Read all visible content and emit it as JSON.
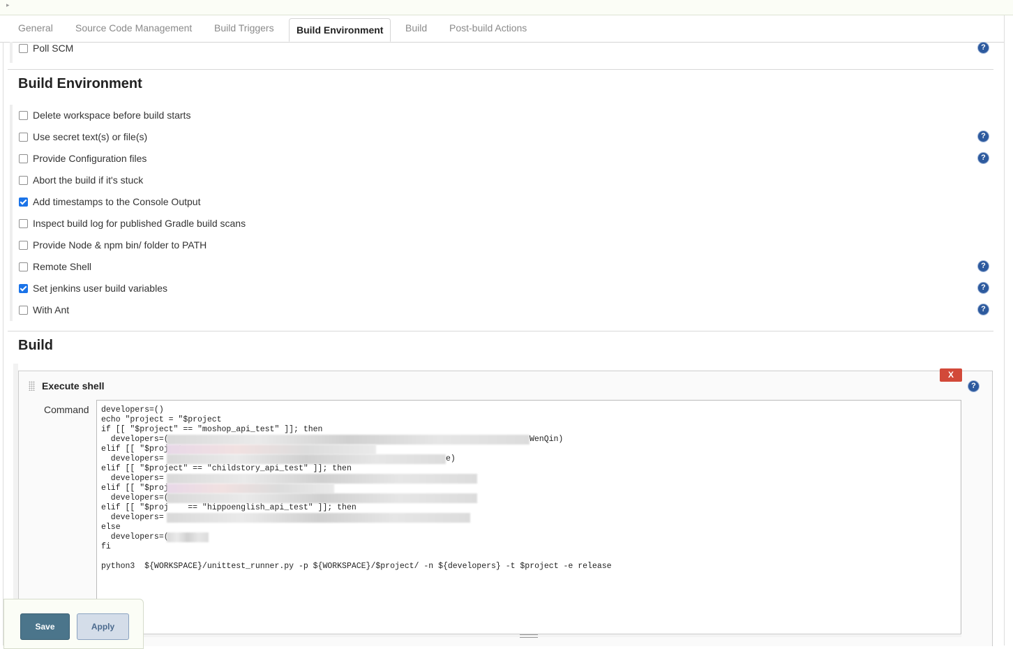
{
  "tabs": [
    "General",
    "Source Code Management",
    "Build Triggers",
    "Build Environment",
    "Build",
    "Post-build Actions"
  ],
  "active_tab": "Build Environment",
  "poll_scm": {
    "label": "Poll SCM",
    "checked": false
  },
  "build_environment": {
    "title": "Build Environment",
    "options": [
      {
        "label": "Delete workspace before build starts",
        "checked": false
      },
      {
        "label": "Use secret text(s) or file(s)",
        "checked": false
      },
      {
        "label": "Provide Configuration files",
        "checked": false
      },
      {
        "label": "Abort the build if it's stuck",
        "checked": false
      },
      {
        "label": "Add timestamps to the Console Output",
        "checked": true
      },
      {
        "label": "Inspect build log for published Gradle build scans",
        "checked": false
      },
      {
        "label": "Provide Node & npm bin/ folder to PATH",
        "checked": false
      },
      {
        "label": "Remote Shell",
        "checked": false
      },
      {
        "label": "Set jenkins user build variables",
        "checked": true
      },
      {
        "label": "With Ant",
        "checked": false
      }
    ]
  },
  "build": {
    "title": "Build",
    "step_title": "Execute shell",
    "delete_label": "X",
    "command_label": "Command",
    "command_lines": [
      "developers=()",
      "echo \"project = \"$project",
      "if [[ \"$project\" == \"moshop_api_test\" ]]; then",
      "  developers=(",
      "elif [[ \"$project",
      "  developers=",
      "elif [[ \"$project\" == \"childstory_api_test\" ]]; then",
      "  developers=",
      "elif [[ \"$proj",
      "  developers=(",
      "elif [[ \"$proj    == \"hippoenglish_api_test\" ]]; then",
      "  developers=",
      "else",
      "  developers=(",
      "fi",
      "",
      "python3  ${WORKSPACE}/unittest_runner.py -p ${WORKSPACE}/$project/ -n ${developers} -t $project -e release"
    ],
    "visible_fragments": {
      "line4_tail": "WenQin)",
      "line6_tail": "e)"
    }
  },
  "buttons": {
    "save": "Save",
    "apply": "Apply"
  },
  "help_icon_glyph": "?"
}
